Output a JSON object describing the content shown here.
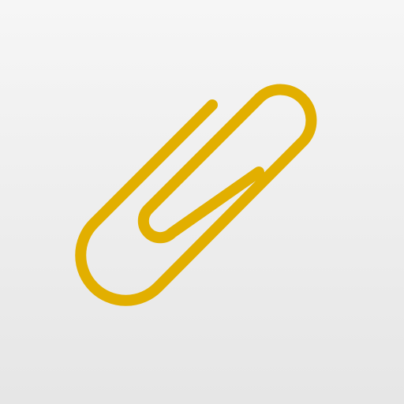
{
  "icon": {
    "name": "paperclip-icon",
    "colors": {
      "clip": "#e2af00",
      "background_top": "#f6f6f6",
      "background_bottom": "#e6e6e6"
    }
  }
}
